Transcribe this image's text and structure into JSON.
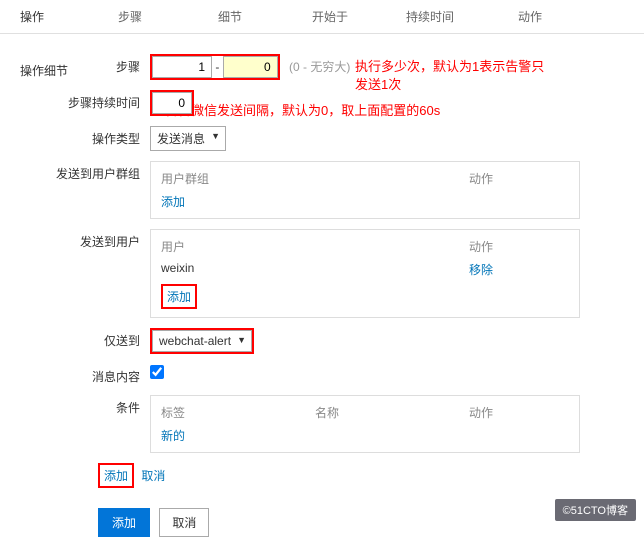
{
  "tabs": {
    "main": "操作",
    "t1": "步骤",
    "t2": "细节",
    "t3": "开始于",
    "t4": "持续时间",
    "t5": "动作"
  },
  "section_title": "操作细节",
  "form": {
    "step_label": "步骤",
    "step_from": "1",
    "step_to": "0",
    "step_hint": "(0 - 无穷大)",
    "duration_label": "步骤持续时间",
    "duration_value": "0",
    "op_type_label": "操作类型",
    "op_type_value": "发送消息",
    "send_group_label": "发送到用户群组",
    "group_header": "用户群组",
    "action_header": "动作",
    "add_link": "添加",
    "send_user_label": "发送到用户",
    "user_header": "用户",
    "user_value": "weixin",
    "remove_link": "移除",
    "only_to_label": "仅送到",
    "only_to_value": "webchat-alert",
    "msg_content_label": "消息内容",
    "condition_label": "条件",
    "tag_header": "标签",
    "name_header": "名称",
    "new_link": "新的"
  },
  "annotations": {
    "a1_line1": "执行多少次，默认为1表示告警只",
    "a1_line2": "发送1次",
    "a2": "告警微信发送间隔，默认为0，取上面配置的60s"
  },
  "bottom": {
    "add": "添加",
    "cancel": "取消"
  },
  "watermark": "©51CTO博客"
}
